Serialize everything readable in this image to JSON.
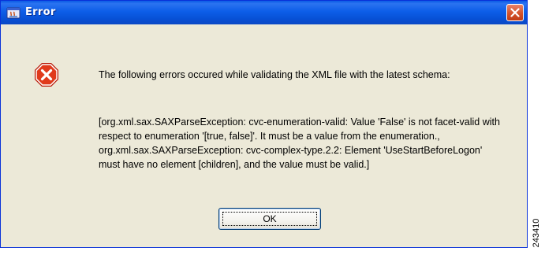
{
  "window": {
    "title": "Error",
    "title_icon": "java-app-icon",
    "close_icon": "close-x-icon"
  },
  "dialog": {
    "icon": "error-stop-icon",
    "message": "The following errors occured while validating the XML file with the latest schema:",
    "details": "[org.xml.sax.SAXParseException: cvc-enumeration-valid: Value 'False' is not facet-valid with respect to enumeration '[true, false]'. It must be a value from the enumeration., org.xml.sax.SAXParseException: cvc-complex-type.2.2: Element 'UseStartBeforeLogon' must have no element [children], and the value must be valid.]",
    "ok_label": "OK"
  },
  "figure_id": "243410",
  "colors": {
    "titlebar": "#0a5be6",
    "dialog_bg": "#ece9d8",
    "error_red": "#d8260f",
    "close_button": "#d4532b"
  }
}
